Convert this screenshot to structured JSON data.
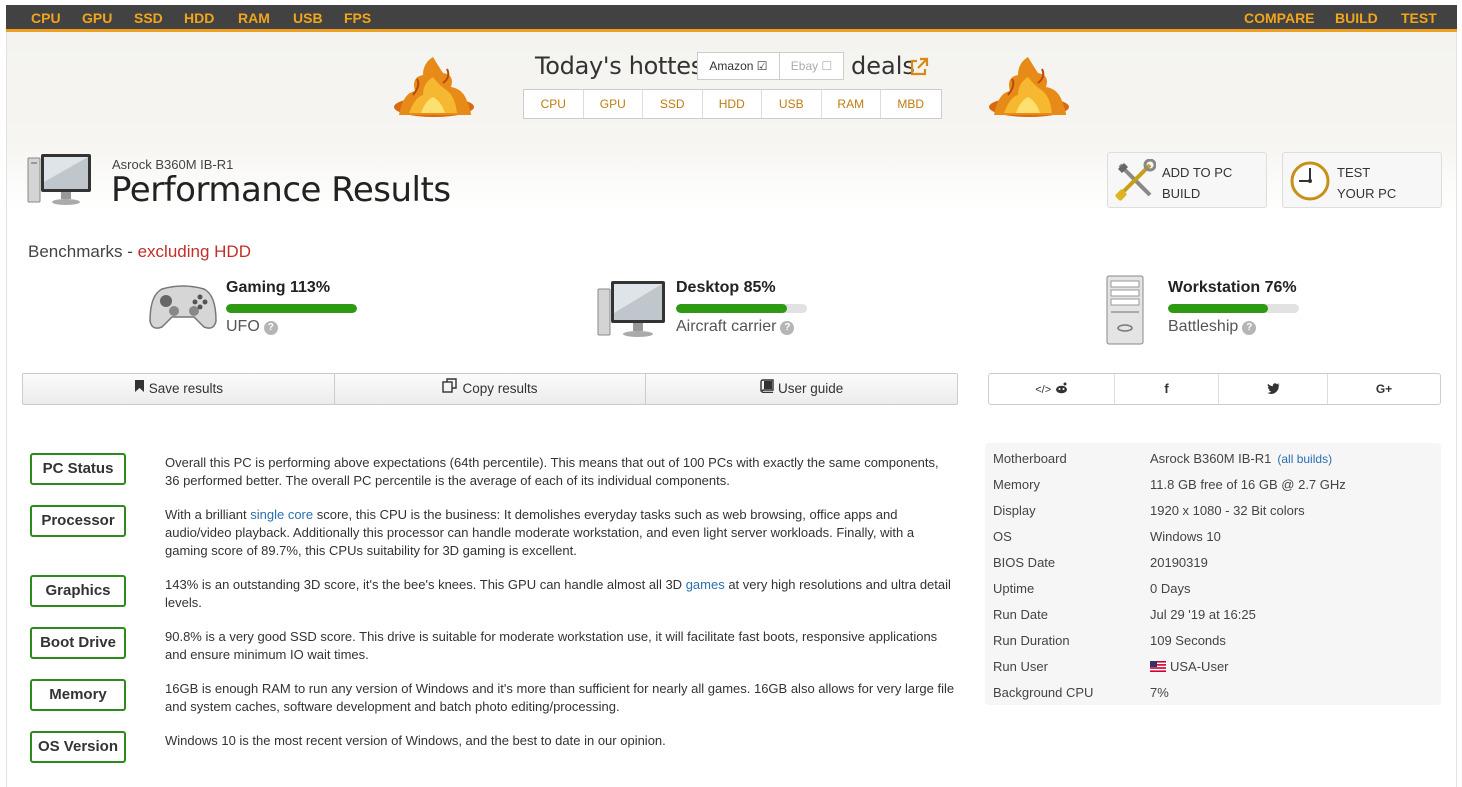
{
  "nav": {
    "left": [
      "CPU",
      "GPU",
      "SSD",
      "HDD",
      "RAM",
      "USB",
      "FPS"
    ],
    "right": [
      "COMPARE",
      "BUILD",
      "TEST"
    ]
  },
  "deals": {
    "title": "Today's hottest",
    "amazon": "Amazon",
    "ebay": "Ebay",
    "suffix": "deals",
    "tabs": [
      "CPU",
      "GPU",
      "SSD",
      "HDD",
      "USB",
      "RAM",
      "MBD"
    ]
  },
  "header": {
    "model": "Asrock B360M IB-R1",
    "title": "Performance Results",
    "add_btn_line1": "ADD TO PC",
    "add_btn_line2": "BUILD",
    "test_btn_line1": "TEST",
    "test_btn_line2": "YOUR PC"
  },
  "benchmarks": {
    "heading": "Benchmarks - ",
    "heading_excl": "excluding HDD",
    "items": [
      {
        "name": "Gaming 113%",
        "rank": "UFO",
        "percent": 100
      },
      {
        "name": "Desktop 85%",
        "rank": "Aircraft carrier",
        "percent": 85
      },
      {
        "name": "Workstation 76%",
        "rank": "Battleship",
        "percent": 76
      }
    ]
  },
  "toolbar": {
    "save": "Save results",
    "copy": "Copy results",
    "guide": "User guide"
  },
  "share": {
    "embed": "</>",
    "facebook": "f",
    "google": "G+"
  },
  "status": [
    {
      "tag": "PC Status",
      "text": "Overall this PC is performing above expectations (64th percentile). This means that out of 100 PCs with exactly the same components, 36 performed better. The overall PC percentile is the average of each of its individual components."
    },
    {
      "tag": "Processor",
      "text_a": "With a brilliant ",
      "link": "single core",
      "text_b": " score, this CPU is the business: It demolishes everyday tasks such as web browsing, office apps and audio/video playback. Additionally this processor can handle moderate workstation, and even light server workloads. Finally, with a gaming score of 89.7%, this CPUs suitability for 3D gaming is excellent."
    },
    {
      "tag": "Graphics",
      "text_a": "143% is an outstanding 3D score, it's the bee's knees. This GPU can handle almost all 3D ",
      "link": "games",
      "text_b": " at very high resolutions and ultra detail levels."
    },
    {
      "tag": "Boot Drive",
      "text": "90.8% is a very good SSD score. This drive is suitable for moderate workstation use, it will facilitate fast boots, responsive applications and ensure minimum IO wait times."
    },
    {
      "tag": "Memory",
      "text": "16GB is enough RAM to run any version of Windows and it's more than sufficient for nearly all games. 16GB also allows for very large file and system caches, software development and batch photo editing/processing."
    },
    {
      "tag": "OS Version",
      "text": "Windows 10 is the most recent version of Windows, and the best to date in our opinion."
    }
  ],
  "specs": [
    {
      "k": "Motherboard",
      "v": "Asrock B360M IB-R1",
      "link": "(all builds)"
    },
    {
      "k": "Memory",
      "v": "11.8 GB free of 16 GB @ 2.7 GHz"
    },
    {
      "k": "Display",
      "v": "1920 x 1080 - 32 Bit colors"
    },
    {
      "k": "OS",
      "v": "Windows 10"
    },
    {
      "k": "BIOS Date",
      "v": "20190319"
    },
    {
      "k": "Uptime",
      "v": "0 Days"
    },
    {
      "k": "Run Date",
      "v": "Jul 29 '19 at 16:25"
    },
    {
      "k": "Run Duration",
      "v": "109 Seconds"
    },
    {
      "k": "Run User",
      "v": "USA-User"
    },
    {
      "k": "Background CPU",
      "v": "7%"
    }
  ],
  "colors": {
    "nav_bg": "#424242",
    "nav_text": "#f2a51a",
    "bar_fill": "#2e9a14",
    "tag_border": "#2e8a1c",
    "link": "#2a6fb0",
    "excl": "#c0302a"
  }
}
